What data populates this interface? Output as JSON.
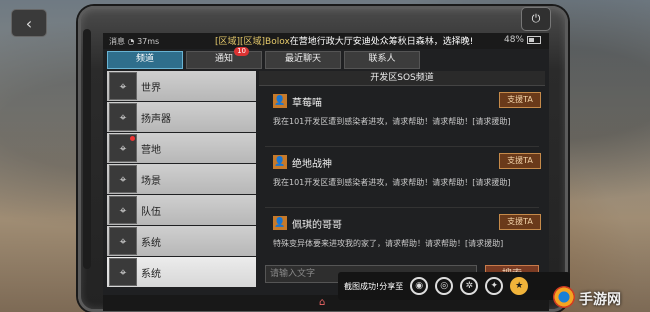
{
  "status": {
    "carrier": "消息",
    "speed": "37ms",
    "battery": "48%"
  },
  "marquee": {
    "channel": "[区域][区域]Bolox",
    "text": "在营地行政大厅安迪处众筹秋日森林，选择晚!"
  },
  "tabs": [
    {
      "label": "频道",
      "active": true
    },
    {
      "label": "通知",
      "badge": "10"
    },
    {
      "label": "最近聊天"
    },
    {
      "label": "联系人"
    }
  ],
  "sidebar": {
    "items": [
      {
        "label": "世界"
      },
      {
        "label": "扬声器"
      },
      {
        "label": "营地"
      },
      {
        "label": "场景"
      },
      {
        "label": "队伍"
      },
      {
        "label": "系统"
      },
      {
        "label": "系统"
      }
    ]
  },
  "chat": {
    "header": "开发区SOS频道",
    "messages": [
      {
        "name": "草莓喵",
        "text": "我在101开发区遭到感染者进攻，请求帮助！请求帮助！[请求援助]",
        "help": "支援TA"
      },
      {
        "name": "绝地战神",
        "text": "我在101开发区遭到感染者进攻，请求帮助！请求帮助！[请求援助]",
        "help": "支援TA"
      },
      {
        "name": "佩琪的哥哥",
        "text": "特殊变异体要来进攻我的家了，请求帮助！请求帮助！[请求援助]",
        "help": "支援TA"
      }
    ]
  },
  "input": {
    "placeholder": "请输入文字",
    "search_label": "搜索"
  },
  "share": {
    "label": "截图成功!分享至"
  },
  "watermark": {
    "text": "手游网"
  },
  "colors": {
    "accent": "#2f6e8c",
    "help_button": "#6a3a1a",
    "badge": "#d33333"
  }
}
